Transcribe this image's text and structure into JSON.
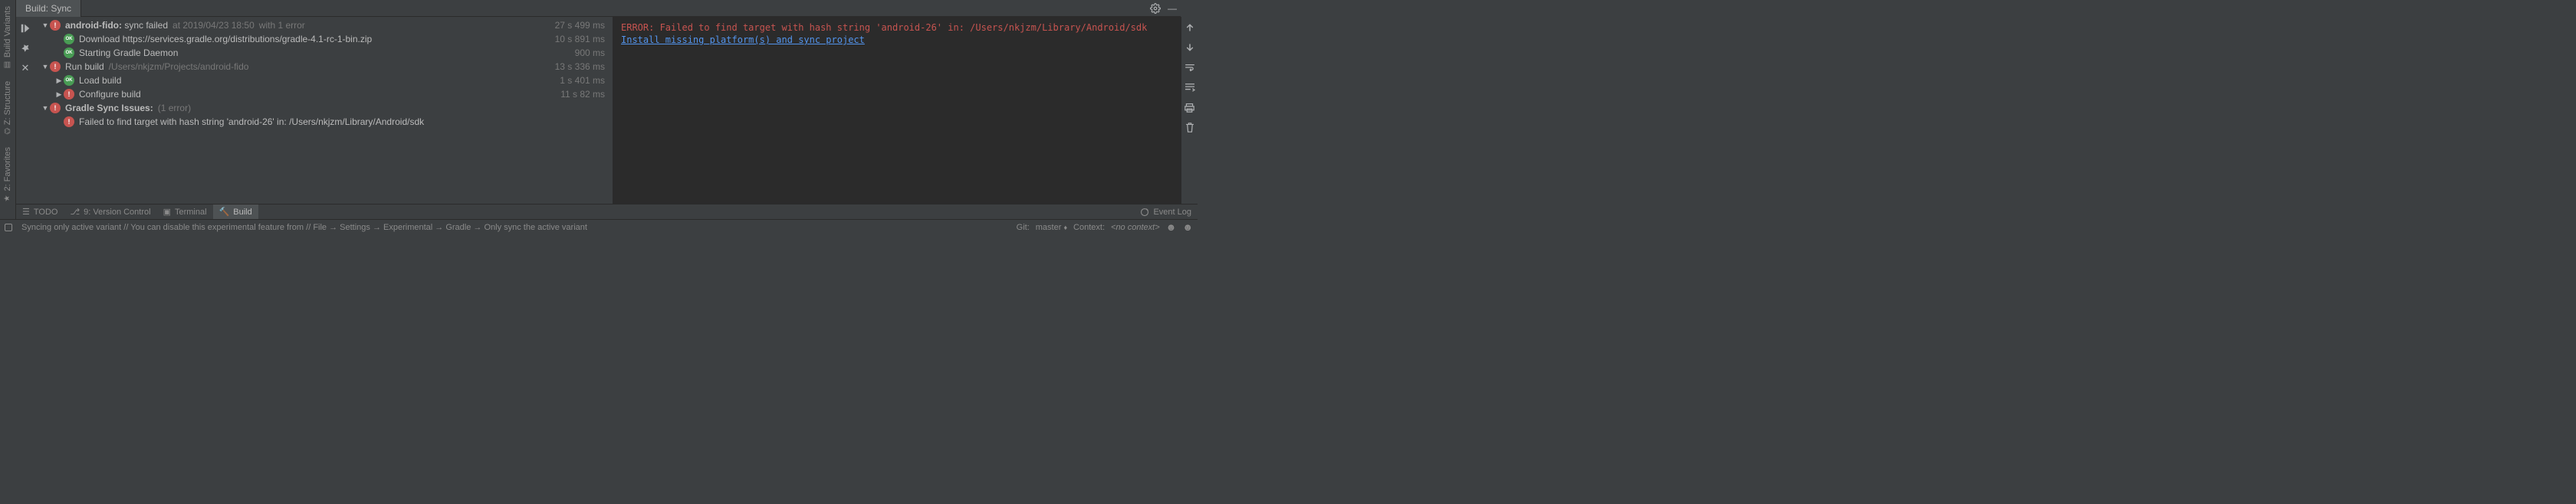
{
  "tab": {
    "title": "Build: Sync"
  },
  "sidebar_left": {
    "tabs": [
      "Build Variants",
      "Z: Structure",
      "2: Favorites"
    ]
  },
  "tree": {
    "rows": [
      {
        "indent": 0,
        "arrow": "down",
        "icon": "err",
        "label_bold": "android-fido:",
        "label_rest": " sync failed",
        "sub1": "at 2019/04/23 18:50",
        "sub2": "with 1 error",
        "time": "27 s 499 ms"
      },
      {
        "indent": 1,
        "arrow": "",
        "icon": "ok",
        "label": "Download https://services.gradle.org/distributions/gradle-4.1-rc-1-bin.zip",
        "time": "10 s 891 ms"
      },
      {
        "indent": 1,
        "arrow": "",
        "icon": "ok",
        "label": "Starting Gradle Daemon",
        "time": "900 ms"
      },
      {
        "indent": 0,
        "arrow": "down",
        "icon": "err",
        "label": "Run build",
        "sub1": "/Users/nkjzm/Projects/android-fido",
        "time": "13 s 336 ms"
      },
      {
        "indent": 1,
        "arrow": "right",
        "icon": "ok",
        "label": "Load build",
        "time": "1 s 401 ms"
      },
      {
        "indent": 1,
        "arrow": "right",
        "icon": "err",
        "label": "Configure build",
        "time": "11 s 82 ms"
      },
      {
        "indent": 0,
        "arrow": "down",
        "icon": "err",
        "label_bold": "Gradle Sync Issues:",
        "sub1": "(1 error)",
        "time": ""
      },
      {
        "indent": 1,
        "arrow": "",
        "icon": "err",
        "label": "Failed to find target with hash string 'android-26' in: /Users/nkjzm/Library/Android/sdk",
        "time": ""
      }
    ]
  },
  "console": {
    "error": "ERROR: Failed to find target with hash string 'android-26' in: /Users/nkjzm/Library/Android/sdk",
    "link": "Install missing platform(s) and sync project"
  },
  "bottom_tabs": {
    "items": [
      {
        "icon": "☰",
        "label": "TODO"
      },
      {
        "icon": "⎇",
        "label": "9: Version Control"
      },
      {
        "icon": "▣",
        "label": "Terminal"
      },
      {
        "icon": "🔨",
        "label": "Build",
        "active": true
      }
    ],
    "event_log": "Event Log"
  },
  "statusbar": {
    "message": "Syncing only active variant // You can disable this experimental feature from // File → Settings → Experimental → Gradle → Only sync the active variant",
    "git_label": "Git:",
    "git_branch": "master",
    "context_label": "Context:",
    "context_value": "<no context>"
  }
}
